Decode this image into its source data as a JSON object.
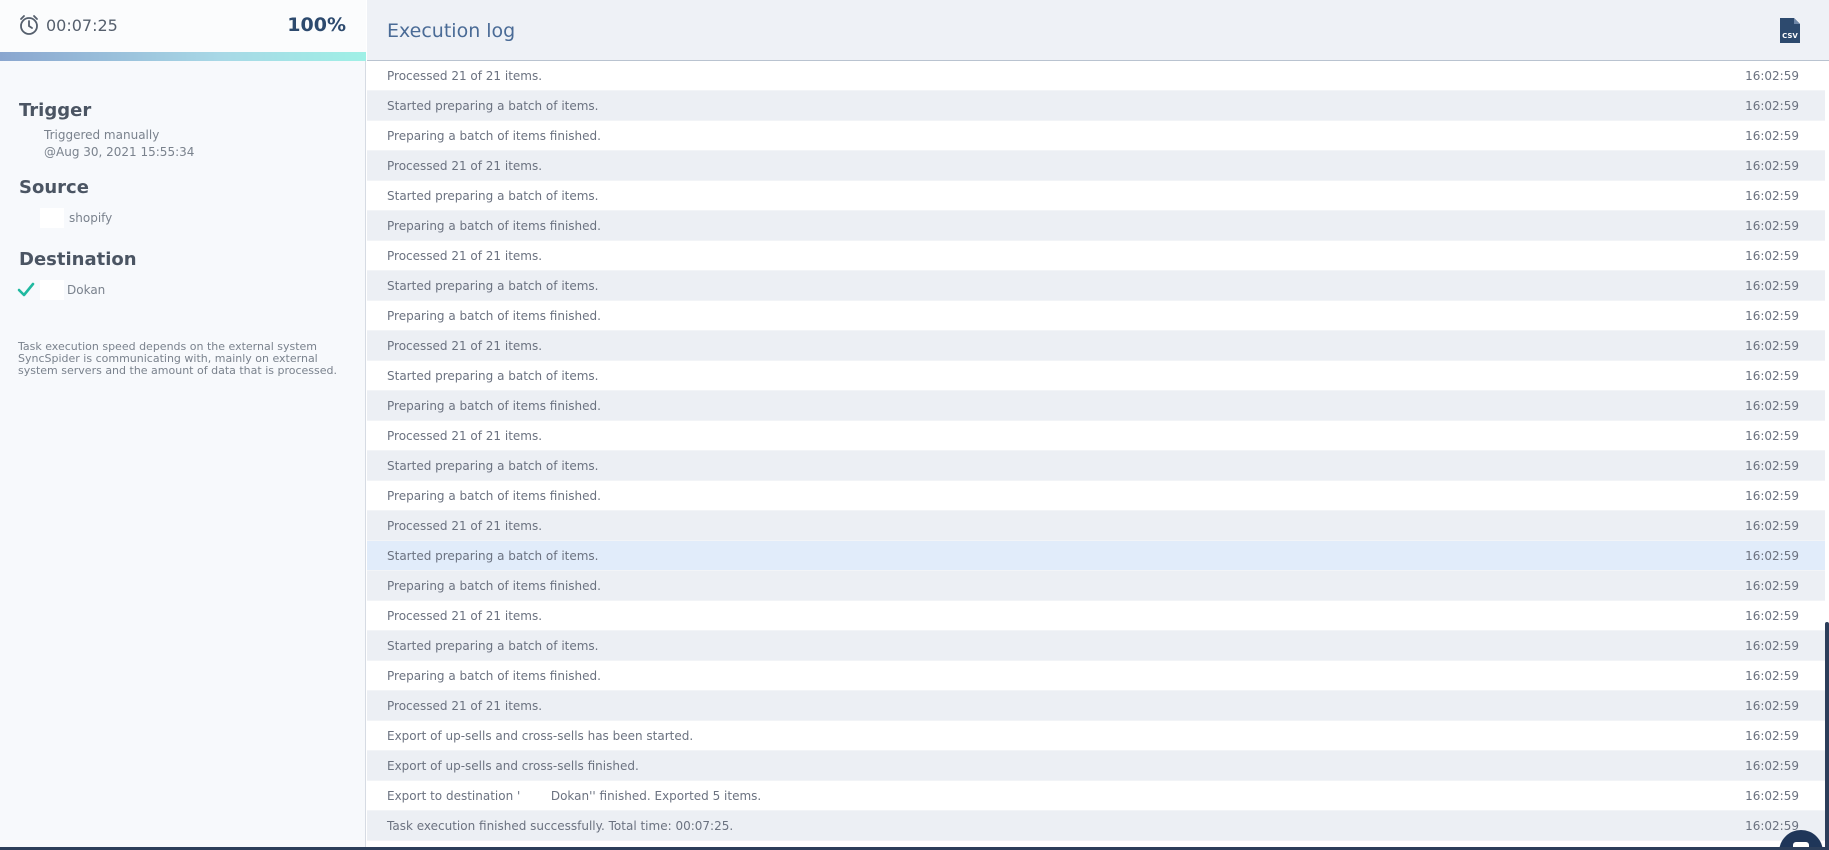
{
  "timer": {
    "elapsed": "00:07:25",
    "percent": "100%",
    "progress": 1.0
  },
  "trigger": {
    "title": "Trigger",
    "line1": "Triggered manually",
    "line2": "@Aug 30, 2021 15:55:34"
  },
  "source": {
    "title": "Source",
    "name": "shopify"
  },
  "destination": {
    "title": "Destination",
    "name": "Dokan",
    "status_icon": "check-icon"
  },
  "note": "Task execution speed depends on the external system SyncSpider is communicating with, mainly on external system servers and the amount of data that is processed.",
  "log": {
    "title": "Execution log",
    "export_icon": "csv-file-icon",
    "export_label": "CSV",
    "rows": [
      {
        "message": "Processed 21 of 21 items.",
        "time": "16:02:59"
      },
      {
        "message": "Started preparing a batch of items.",
        "time": "16:02:59"
      },
      {
        "message": "Preparing a batch of items finished.",
        "time": "16:02:59"
      },
      {
        "message": "Processed 21 of 21 items.",
        "time": "16:02:59"
      },
      {
        "message": "Started preparing a batch of items.",
        "time": "16:02:59"
      },
      {
        "message": "Preparing a batch of items finished.",
        "time": "16:02:59"
      },
      {
        "message": "Processed 21 of 21 items.",
        "time": "16:02:59"
      },
      {
        "message": "Started preparing a batch of items.",
        "time": "16:02:59"
      },
      {
        "message": "Preparing a batch of items finished.",
        "time": "16:02:59"
      },
      {
        "message": "Processed 21 of 21 items.",
        "time": "16:02:59"
      },
      {
        "message": "Started preparing a batch of items.",
        "time": "16:02:59"
      },
      {
        "message": "Preparing a batch of items finished.",
        "time": "16:02:59"
      },
      {
        "message": "Processed 21 of 21 items.",
        "time": "16:02:59"
      },
      {
        "message": "Started preparing a batch of items.",
        "time": "16:02:59"
      },
      {
        "message": "Preparing a batch of items finished.",
        "time": "16:02:59"
      },
      {
        "message": "Processed 21 of 21 items.",
        "time": "16:02:59"
      },
      {
        "message": "Started preparing a batch of items.",
        "time": "16:02:59",
        "highlight": true
      },
      {
        "message": "Preparing a batch of items finished.",
        "time": "16:02:59"
      },
      {
        "message": "Processed 21 of 21 items.",
        "time": "16:02:59"
      },
      {
        "message": "Started preparing a batch of items.",
        "time": "16:02:59"
      },
      {
        "message": "Preparing a batch of items finished.",
        "time": "16:02:59"
      },
      {
        "message": "Processed 21 of 21 items.",
        "time": "16:02:59"
      },
      {
        "message": "Export of up-sells and cross-sells has been started.",
        "time": "16:02:59"
      },
      {
        "message": "Export of up-sells and cross-sells finished.",
        "time": "16:02:59"
      },
      {
        "message": "Export to destination '        Dokan'' finished. Exported 5 items.",
        "time": "16:02:59"
      },
      {
        "message": "Task execution finished successfully. Total time: 00:07:25.",
        "time": "16:02:59"
      }
    ]
  },
  "colors": {
    "accent": "#2d4a6e",
    "header_title": "#4a6b96",
    "success": "#1fb9a0",
    "row_alt": "#eceff4",
    "row_highlight": "#e1ecfa"
  }
}
